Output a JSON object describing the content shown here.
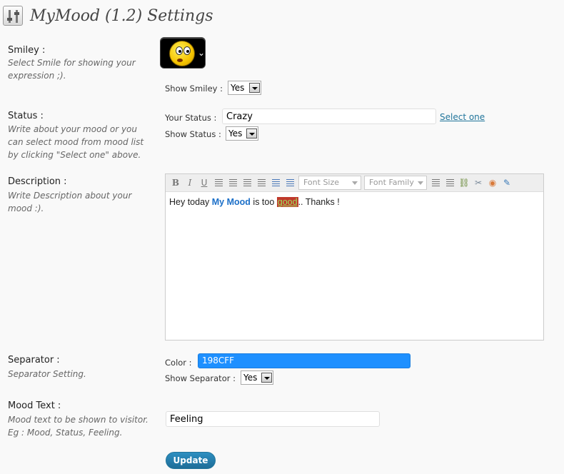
{
  "page": {
    "title": "MyMood (1.2) Settings"
  },
  "smiley": {
    "label": "Smiley :",
    "description": "Select Smile for showing your expression ;).",
    "show_label": "Show Smiley :",
    "show_value": "Yes"
  },
  "status": {
    "label": "Status :",
    "description": "Write about your mood or you can select mood from mood list by clicking \"Select one\" above.",
    "your_status_label": "Your Status :",
    "your_status_value": "Crazy",
    "select_one_link": "Select one",
    "show_label": "Show Status :",
    "show_value": "Yes"
  },
  "description": {
    "label": "Description :",
    "description": "Write Description about your mood :).",
    "toolbar": {
      "bold": "B",
      "italic": "I",
      "underline": "U",
      "font_size_placeholder": "Font Size",
      "font_family_placeholder": "Font Family"
    },
    "content": {
      "part1": "Hey today ",
      "strong": "My Mood",
      "part2": " is too ",
      "highlight": "good",
      "part3": ".. Thanks !"
    }
  },
  "separator": {
    "label": "Separator :",
    "description": "Separator Setting.",
    "color_label": "Color :",
    "color_value": "198CFF",
    "show_label": "Show Separator :",
    "show_value": "Yes"
  },
  "mood_text": {
    "label": "Mood Text :",
    "description": "Mood text to be shown to visitor. Eg : Mood, Status, Feeling.",
    "value": "Feeling"
  },
  "actions": {
    "update_label": "Update"
  },
  "colors": {
    "background": "#f9f9f9",
    "link": "#21759b",
    "separator_color": "#198CFF",
    "button": "#21759b"
  },
  "icons": [
    "settings-icon",
    "smiley-face-icon",
    "bold-icon",
    "italic-icon",
    "underline-icon",
    "align-left-icon",
    "align-center-icon",
    "align-right-icon",
    "align-justify-icon",
    "ordered-list-icon",
    "unordered-list-icon",
    "outdent-icon",
    "indent-icon",
    "link-icon",
    "unlink-icon",
    "image-icon",
    "html-edit-icon"
  ]
}
